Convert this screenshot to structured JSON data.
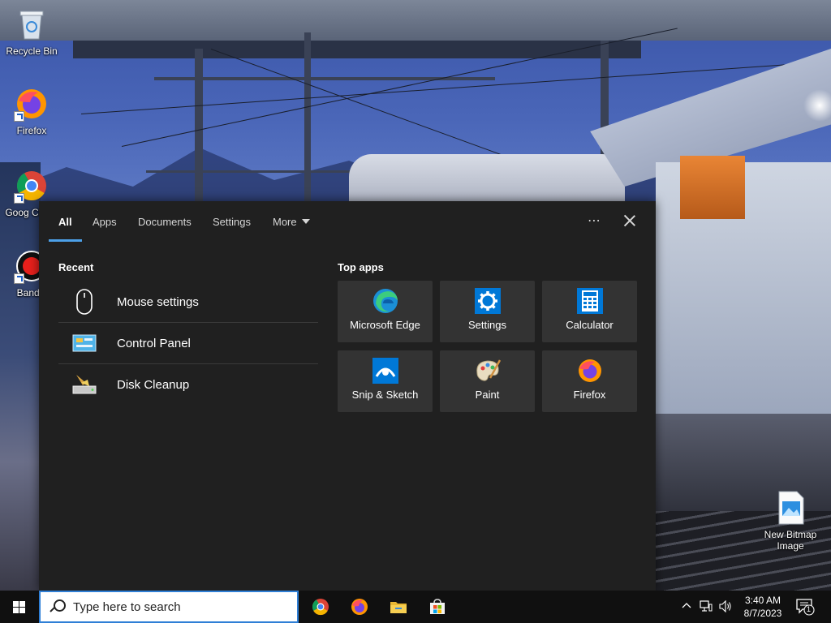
{
  "desktop": {
    "icons": [
      {
        "label": "Recycle Bin"
      },
      {
        "label": "Firefox"
      },
      {
        "label": "Goog Chron"
      },
      {
        "label": "Bandic"
      },
      {
        "label": "New Bitmap Image"
      }
    ]
  },
  "search_panel": {
    "tabs": [
      {
        "label": "All"
      },
      {
        "label": "Apps"
      },
      {
        "label": "Documents"
      },
      {
        "label": "Settings"
      },
      {
        "label": "More"
      }
    ],
    "more_menu": "⋯",
    "recent": {
      "title": "Recent",
      "items": [
        {
          "label": "Mouse settings",
          "icon": "mouse-icon"
        },
        {
          "label": "Control Panel",
          "icon": "control-panel-icon"
        },
        {
          "label": "Disk Cleanup",
          "icon": "disk-cleanup-icon"
        }
      ]
    },
    "top_apps": {
      "title": "Top apps",
      "items": [
        {
          "label": "Microsoft Edge",
          "icon": "edge-icon"
        },
        {
          "label": "Settings",
          "icon": "gear-icon"
        },
        {
          "label": "Calculator",
          "icon": "calculator-icon"
        },
        {
          "label": "Snip & Sketch",
          "icon": "snip-sketch-icon"
        },
        {
          "label": "Paint",
          "icon": "paint-icon"
        },
        {
          "label": "Firefox",
          "icon": "firefox-icon"
        }
      ]
    }
  },
  "taskbar": {
    "search_placeholder": "Type here to search",
    "pinned": [
      "chrome-icon",
      "firefox-icon",
      "file-explorer-icon",
      "store-icon"
    ],
    "clock": {
      "time": "3:40 AM",
      "date": "8/7/2023"
    },
    "notification_count": "1"
  },
  "colors": {
    "accent": "#4ca0e8",
    "panel_bg": "#202020",
    "tile_bg": "#333333",
    "taskbar_bg": "#101010"
  }
}
